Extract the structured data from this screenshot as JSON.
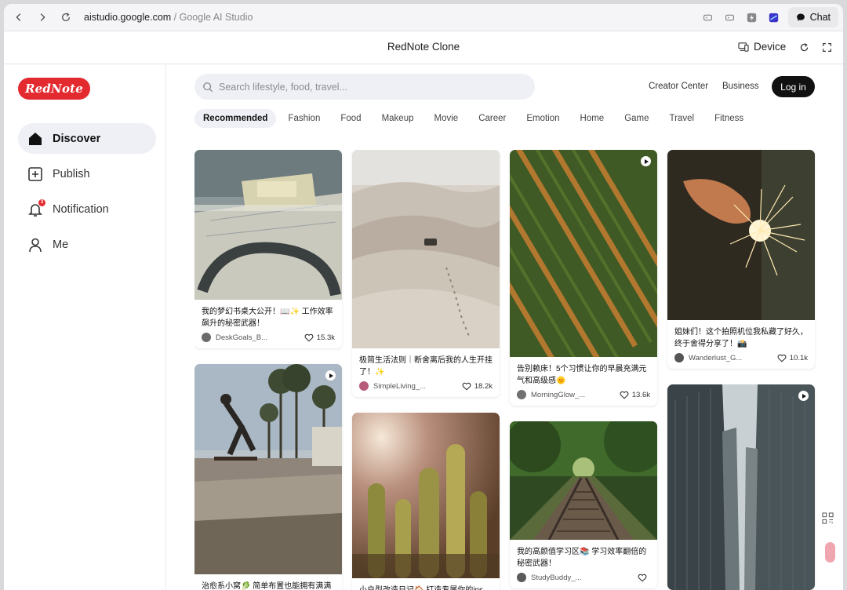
{
  "browser": {
    "url_host": "aistudio.google.com",
    "url_sep": " / ",
    "url_page": "Google AI Studio",
    "chat_label": "Chat"
  },
  "app_header": {
    "title": "RedNote Clone",
    "device_label": "Device"
  },
  "sidebar": {
    "logo": "RedNote",
    "items": [
      {
        "label": "Discover",
        "icon": "home-icon",
        "active": true
      },
      {
        "label": "Publish",
        "icon": "plus-square-icon"
      },
      {
        "label": "Notification",
        "icon": "bell-icon",
        "badge": "3"
      },
      {
        "label": "Me",
        "icon": "user-icon"
      }
    ]
  },
  "search": {
    "placeholder": "Search lifestyle, food, travel..."
  },
  "top_links": {
    "creator_center": "Creator Center",
    "business": "Business",
    "login": "Log in"
  },
  "categories": [
    "Recommended",
    "Fashion",
    "Food",
    "Makeup",
    "Movie",
    "Career",
    "Emotion",
    "Home",
    "Game",
    "Travel",
    "Fitness"
  ],
  "feed": [
    {
      "title": "我的梦幻书桌大公开！📖✨ 工作效率飙升的秘密武器！",
      "author": "DeskGoals_B...",
      "likes": "15.3k",
      "image": "desk-blueprint-photo",
      "video": false
    },
    {
      "title": "治愈系小窝🥬 简单布置也能拥有满满",
      "author": "",
      "likes": "",
      "image": "skatepark-palm-photo",
      "video": true
    },
    {
      "title": "极简生活法则｜断舍离后我的人生开挂了！✨",
      "author": "SimpleLiving_...",
      "likes": "18.2k",
      "image": "desert-dunes-photo",
      "video": false
    },
    {
      "title": "小户型改造日记🏠 打造专属你的ins",
      "author": "",
      "likes": "",
      "image": "cactus-sunlight-photo",
      "video": false
    },
    {
      "title": "告别赖床！5个习惯让你的早晨充满元气和高级感🌞",
      "author": "MorningGlow_...",
      "likes": "13.6k",
      "image": "green-field-rows-photo",
      "video": true
    },
    {
      "title": "我的高颜值学习区📚 学习效率翻倍的秘密武器！",
      "author": "StudyBuddy_...",
      "likes": "",
      "image": "forest-railway-photo",
      "video": false
    },
    {
      "title": "姐妹们！这个拍照机位我私藏了好久，终于舍得分享了！📸",
      "author": "Wanderlust_G...",
      "likes": "10.1k",
      "image": "sparkler-hand-photo",
      "video": false
    },
    {
      "title": "",
      "author": "",
      "likes": "",
      "image": "skyscrapers-photo",
      "video": true
    }
  ],
  "colors": {
    "brand_red": "#e32a2f",
    "login_bg": "#111111",
    "chip_bg": "#eef0f5"
  }
}
